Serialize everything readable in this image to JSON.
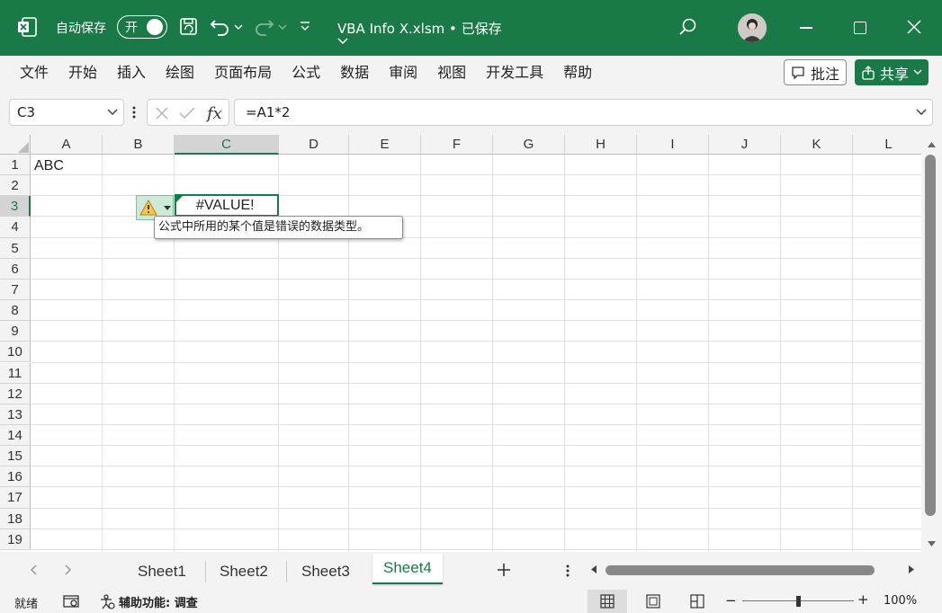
{
  "titlebar": {
    "autosave_label": "自动保存",
    "autosave_state": "开",
    "document_title": "VBA Info X.xlsm",
    "save_status": "已保存",
    "bg_color": "#1a7a47"
  },
  "menu": [
    "文件",
    "开始",
    "插入",
    "绘图",
    "页面布局",
    "公式",
    "数据",
    "审阅",
    "视图",
    "开发工具",
    "帮助"
  ],
  "actions": {
    "comment_label": "批注",
    "share_label": "共享"
  },
  "formula_bar": {
    "name_box": "C3",
    "formula": "=A1*2"
  },
  "columns": [
    "A",
    "B",
    "C",
    "D",
    "E",
    "F",
    "G",
    "H",
    "I",
    "J",
    "K",
    "L"
  ],
  "rows": [
    "1",
    "2",
    "3",
    "4",
    "5",
    "6",
    "7",
    "8",
    "9",
    "10",
    "11",
    "12",
    "13",
    "14",
    "15",
    "16",
    "17",
    "18",
    "19"
  ],
  "selected": {
    "column": "C",
    "row": "3"
  },
  "cells": {
    "A1": "ABC",
    "C3": "#VALUE!"
  },
  "error_tooltip": "公式中所用的某个值是错误的数据类型。",
  "sheets": [
    "Sheet1",
    "Sheet2",
    "Sheet3",
    "Sheet4"
  ],
  "active_sheet": "Sheet4",
  "status": {
    "ready": "就绪",
    "accessibility": "辅助功能: 调查",
    "zoom": "100%",
    "zoom_minus": "−",
    "zoom_plus": "+",
    "zoom_level": 0.5
  },
  "icons": [
    "excel-logo-icon",
    "save-icon",
    "undo-icon",
    "redo-icon",
    "customize-icon",
    "search-icon",
    "avatar",
    "minimize-icon",
    "maximize-icon",
    "close-icon",
    "comment-icon",
    "share-icon",
    "warning-icon",
    "dropdown-icon",
    "cancel-icon",
    "enter-icon",
    "fx-icon",
    "normal-view-icon",
    "page-layout-icon",
    "page-break-icon"
  ]
}
